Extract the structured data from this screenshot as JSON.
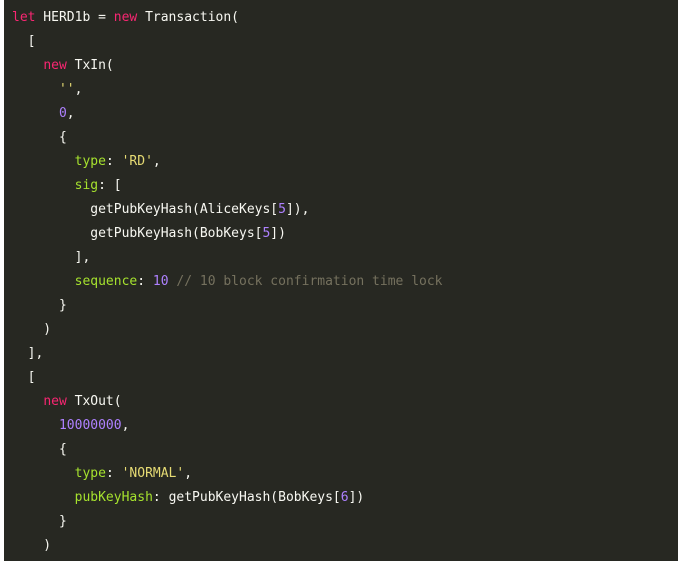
{
  "editor": {
    "background": "#272822",
    "colors": {
      "keyword": "#f92672",
      "identifier": "#f8f8f2",
      "string": "#e6db74",
      "number": "#ae81ff",
      "property": "#a6e22e",
      "comment": "#75715e"
    },
    "lines": [
      [
        {
          "t": "kw",
          "v": "let"
        },
        {
          "t": "id",
          "v": " HERD1b = "
        },
        {
          "t": "kw",
          "v": "new"
        },
        {
          "t": "id",
          "v": " Transaction("
        }
      ],
      [
        {
          "t": "punc",
          "v": "  ["
        }
      ],
      [
        {
          "t": "punc",
          "v": "    "
        },
        {
          "t": "kw",
          "v": "new"
        },
        {
          "t": "id",
          "v": " TxIn("
        }
      ],
      [
        {
          "t": "punc",
          "v": "      "
        },
        {
          "t": "str",
          "v": "''"
        },
        {
          "t": "punc",
          "v": ","
        }
      ],
      [
        {
          "t": "punc",
          "v": "      "
        },
        {
          "t": "num",
          "v": "0"
        },
        {
          "t": "punc",
          "v": ","
        }
      ],
      [
        {
          "t": "punc",
          "v": "      {"
        }
      ],
      [
        {
          "t": "punc",
          "v": "        "
        },
        {
          "t": "prop",
          "v": "type"
        },
        {
          "t": "punc",
          "v": ": "
        },
        {
          "t": "str",
          "v": "'RD'"
        },
        {
          "t": "punc",
          "v": ","
        }
      ],
      [
        {
          "t": "punc",
          "v": "        "
        },
        {
          "t": "prop",
          "v": "sig"
        },
        {
          "t": "punc",
          "v": ": ["
        }
      ],
      [
        {
          "t": "punc",
          "v": "          "
        },
        {
          "t": "id",
          "v": "getPubKeyHash(AliceKeys["
        },
        {
          "t": "num",
          "v": "5"
        },
        {
          "t": "id",
          "v": "]),"
        }
      ],
      [
        {
          "t": "punc",
          "v": "          "
        },
        {
          "t": "id",
          "v": "getPubKeyHash(BobKeys["
        },
        {
          "t": "num",
          "v": "5"
        },
        {
          "t": "id",
          "v": "])"
        }
      ],
      [
        {
          "t": "punc",
          "v": "        ],"
        }
      ],
      [
        {
          "t": "punc",
          "v": "        "
        },
        {
          "t": "prop",
          "v": "sequence"
        },
        {
          "t": "punc",
          "v": ": "
        },
        {
          "t": "num",
          "v": "10"
        },
        {
          "t": "punc",
          "v": " "
        },
        {
          "t": "comment",
          "v": "// 10 block confirmation time lock"
        }
      ],
      [
        {
          "t": "punc",
          "v": "      }"
        }
      ],
      [
        {
          "t": "punc",
          "v": "    )"
        }
      ],
      [
        {
          "t": "punc",
          "v": "  ],"
        }
      ],
      [
        {
          "t": "punc",
          "v": "  ["
        }
      ],
      [
        {
          "t": "punc",
          "v": "    "
        },
        {
          "t": "kw",
          "v": "new"
        },
        {
          "t": "id",
          "v": " TxOut("
        }
      ],
      [
        {
          "t": "punc",
          "v": "      "
        },
        {
          "t": "num",
          "v": "10000000"
        },
        {
          "t": "punc",
          "v": ","
        }
      ],
      [
        {
          "t": "punc",
          "v": "      {"
        }
      ],
      [
        {
          "t": "punc",
          "v": "        "
        },
        {
          "t": "prop",
          "v": "type"
        },
        {
          "t": "punc",
          "v": ": "
        },
        {
          "t": "str",
          "v": "'NORMAL'"
        },
        {
          "t": "punc",
          "v": ","
        }
      ],
      [
        {
          "t": "punc",
          "v": "        "
        },
        {
          "t": "prop",
          "v": "pubKeyHash"
        },
        {
          "t": "punc",
          "v": ": "
        },
        {
          "t": "id",
          "v": "getPubKeyHash(BobKeys["
        },
        {
          "t": "num",
          "v": "6"
        },
        {
          "t": "id",
          "v": "])"
        }
      ],
      [
        {
          "t": "punc",
          "v": "      }"
        }
      ],
      [
        {
          "t": "punc",
          "v": "    )"
        }
      ]
    ]
  }
}
